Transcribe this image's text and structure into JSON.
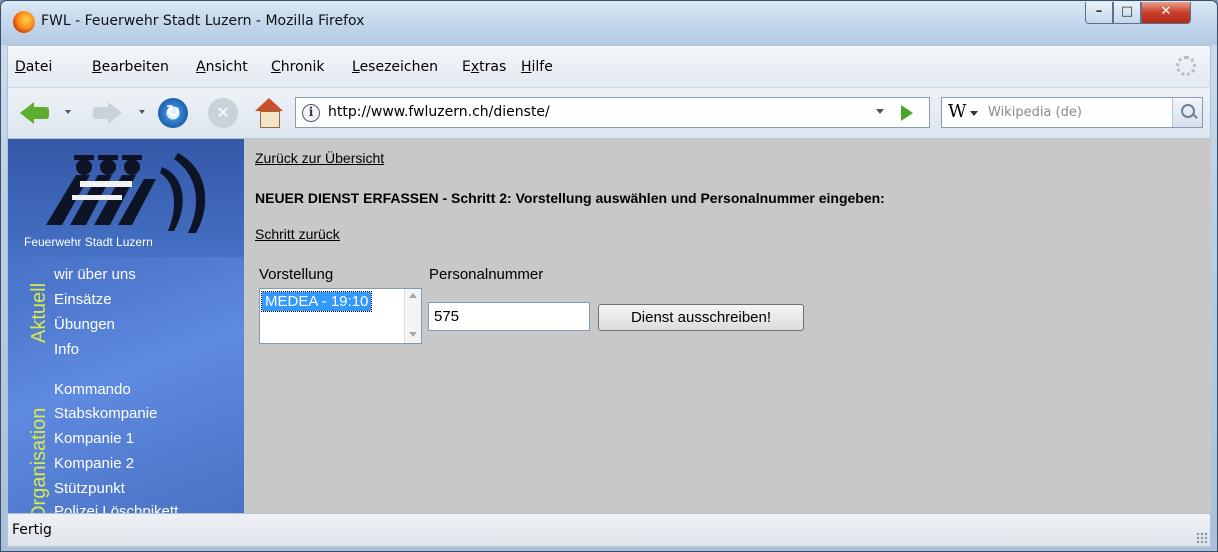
{
  "window": {
    "title": "FWL - Feuerwehr Stadt Luzern - Mozilla Firefox",
    "minimize": "–",
    "maximize": "□",
    "close": "✕"
  },
  "menu": {
    "items": [
      "Datei",
      "Bearbeiten",
      "Ansicht",
      "Chronik",
      "Lesezeichen",
      "Extras",
      "Hilfe"
    ],
    "accelerators": [
      "D",
      "B",
      "A",
      "C",
      "L",
      "x",
      "H"
    ]
  },
  "nav": {
    "url": "http://www.fwluzern.ch/dienste/",
    "site_icon": "i",
    "reload_glyph": "↻",
    "stop_glyph": "✕",
    "search_engine_glyph": "W",
    "search_placeholder": "Wikipedia (de)"
  },
  "sidebar": {
    "logo_name": "Feuerwehr Stadt Luzern",
    "section_aktuell": "Aktuell",
    "aktuell_links": [
      "wir über uns",
      "Einsätze",
      "Übungen",
      "Info"
    ],
    "section_organisation": "Organisation",
    "organisation_links": [
      "Kommando",
      "Stabskompanie",
      "Kompanie 1",
      "Kompanie 2",
      "Stützpunkt",
      "Polizei Löschpikett"
    ]
  },
  "main": {
    "back_link": "Zurück zur Übersicht",
    "heading": "NEUER DIENST ERFASSEN - Schritt 2: Vorstellung auswählen und Personalnummer eingeben:",
    "step_back_link": "Schritt zurück",
    "vorstellung_label": "Vorstellung",
    "vorstellung_options": [
      "MEDEA - 19:10"
    ],
    "personalnummer_label": "Personalnummer",
    "personalnummer_value": "575",
    "submit_label": "Dienst ausschreiben!"
  },
  "status": {
    "text": "Fertig"
  },
  "colors": {
    "page_background": "#c8c8c8",
    "sidebar_blue": "#4f7ad0",
    "section_label": "#d9e94a",
    "selection": "#3399ff"
  },
  "icons": [
    "firefox-icon",
    "back-arrow-icon",
    "forward-arrow-icon",
    "reload-icon",
    "stop-icon",
    "home-icon",
    "site-identity-icon",
    "go-arrow-icon",
    "wikipedia-icon",
    "search-magnifier-icon",
    "throbber-icon",
    "resize-grip-icon"
  ]
}
